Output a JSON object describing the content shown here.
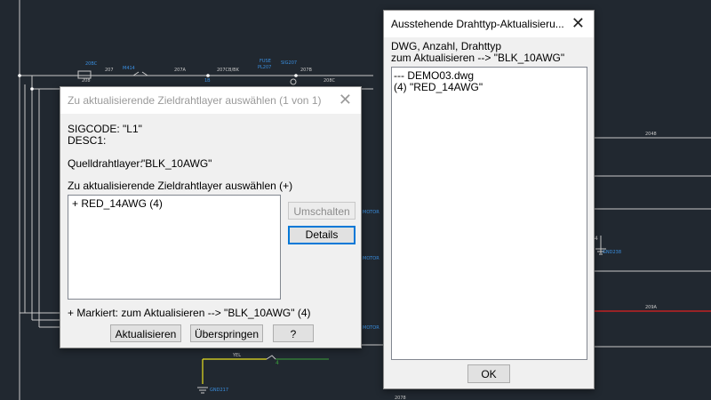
{
  "cad": {
    "labels": {
      "l1": "20BC",
      "l2": "208",
      "l3": "207",
      "l4": "M414",
      "l5": "207A",
      "l6": "207CB/BK",
      "l7": "FUSE",
      "l8": "PL207",
      "l9": "SIG207",
      "l10": "207B",
      "l11": "1B",
      "l12": "208C",
      "l13": "2048",
      "l14": "MOTOR",
      "l15": "MOTOR",
      "l16": "GND238",
      "l17": "209A",
      "l18": "MOTOR",
      "l19": "YEL",
      "l20": "4",
      "l21": "GND217",
      "l22": "2078",
      "l23": "4"
    }
  },
  "dialog_layer": {
    "title": "Zu aktualisierende Zieldrahtlayer auswählen  (1 von 1)",
    "close": "✕",
    "sigcode": "SIGCODE: \"L1\"",
    "desc1": "DESC1:",
    "source_label": "Quelldrahtlayer:",
    "source_value": "\"BLK_10AWG\"",
    "select_prompt": "Zu aktualisierende Zieldrahtlayer auswählen (+)",
    "list_items": [
      "+ RED_14AWG  (4)"
    ],
    "toggle_button": "Umschalten",
    "details_button": "Details",
    "marked_note": "+  Markiert: zum Aktualisieren --> \"BLK_10AWG\" (4)",
    "update_button": "Aktualisieren",
    "skip_button": "Überspringen",
    "help_button": "?"
  },
  "dialog_pending": {
    "title": "Ausstehende Drahttyp-Aktualisieru...",
    "close": "✕",
    "header_line1": "DWG, Anzahl, Drahttyp",
    "header_line2": "zum Aktualisieren --> \"BLK_10AWG\"",
    "list_items": [
      "--- DEMO03.dwg",
      "(4)  \"RED_14AWG\""
    ],
    "ok_button": "OK"
  }
}
